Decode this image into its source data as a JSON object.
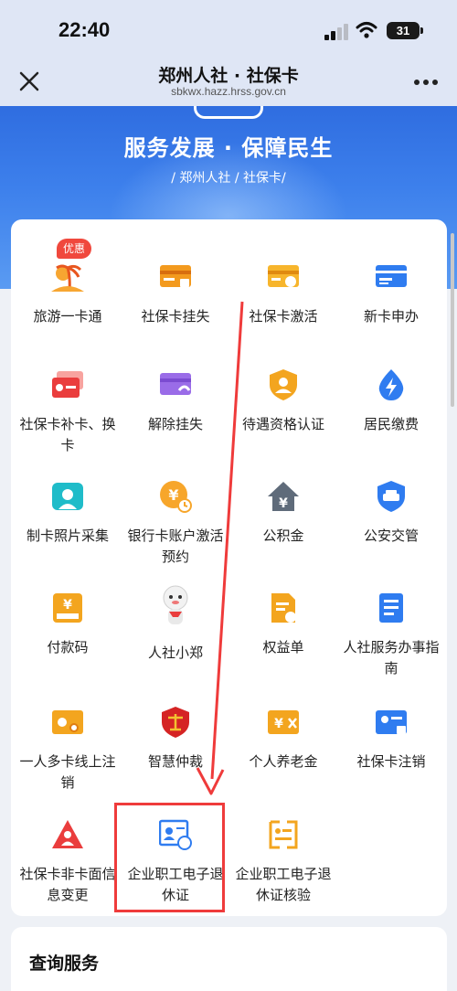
{
  "status_bar": {
    "time": "22:40",
    "battery": "31"
  },
  "nav": {
    "title": "郑州人社 · 社保卡",
    "url": "sbkwx.hazz.hrss.gov.cn"
  },
  "banner": {
    "slogan": "服务发展 · 保障民生",
    "sub": "/ 郑州人社 / 社保卡/"
  },
  "services": [
    {
      "label": "旅游一卡通",
      "icon": "tourism-icon",
      "badge": "优惠"
    },
    {
      "label": "社保卡挂失",
      "icon": "card-lock-icon"
    },
    {
      "label": "社保卡激活",
      "icon": "card-activate-icon"
    },
    {
      "label": "新卡申办",
      "icon": "new-card-icon"
    },
    {
      "label": "社保卡补卡、换卡",
      "icon": "card-replace-icon"
    },
    {
      "label": "解除挂失",
      "icon": "unlock-card-icon"
    },
    {
      "label": "待遇资格认证",
      "icon": "qualification-shield-icon"
    },
    {
      "label": "居民缴费",
      "icon": "lightning-payment-icon"
    },
    {
      "label": "制卡照片采集",
      "icon": "camera-icon"
    },
    {
      "label": "银行卡账户激活预约",
      "icon": "yuan-clock-icon"
    },
    {
      "label": "公积金",
      "icon": "house-yuan-icon"
    },
    {
      "label": "公安交管",
      "icon": "police-car-shield-icon"
    },
    {
      "label": "付款码",
      "icon": "yuan-tray-icon"
    },
    {
      "label": "人社小郑",
      "icon": "mascot-icon"
    },
    {
      "label": "权益单",
      "icon": "document-star-icon"
    },
    {
      "label": "人社服务办事指南",
      "icon": "guide-document-icon"
    },
    {
      "label": "一人多卡线上注销",
      "icon": "multi-card-icon"
    },
    {
      "label": "智慧仲裁",
      "icon": "scales-shield-icon"
    },
    {
      "label": "个人养老金",
      "icon": "pension-card-icon"
    },
    {
      "label": "社保卡注销",
      "icon": "id-card-cancel-icon"
    },
    {
      "label": "社保卡非卡面信息变更",
      "icon": "warning-person-icon"
    },
    {
      "label": "企业职工电子退休证",
      "icon": "retirement-certificate-icon"
    },
    {
      "label": "企业职工电子退休证核验",
      "icon": "certificate-verify-icon"
    }
  ],
  "query_section": {
    "title": "查询服务"
  },
  "colors": {
    "accent_blue": "#3d7ff0",
    "orange": "#f39a1e",
    "red": "#ef3b3b",
    "annotation": "#ef3b3b"
  }
}
